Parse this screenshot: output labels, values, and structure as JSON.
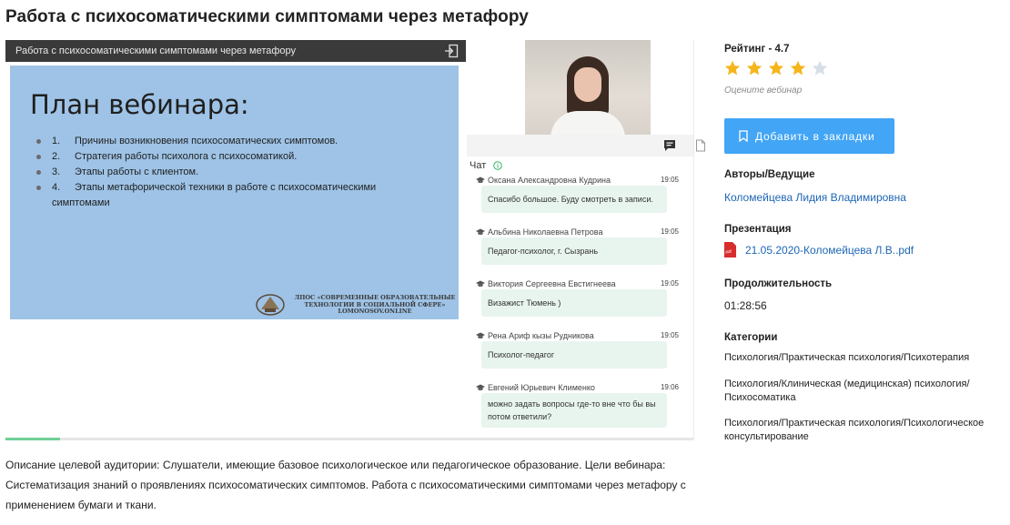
{
  "page": {
    "title": "Работа с психосоматическими симптомами через метафору"
  },
  "player": {
    "header_title": "Работа с психосоматическими симптомами через метафору",
    "slide": {
      "title": "План вебинара:",
      "items": [
        {
          "num": "1.",
          "text": "Причины возникновения психосоматических симптомов."
        },
        {
          "num": "2.",
          "text": "Стратегия работы психолога с психосоматикой."
        },
        {
          "num": "3.",
          "text": "Этапы работы с клиентом."
        },
        {
          "num": "4.",
          "text": "Этапы метафорической техники в работе с психосоматическими симптомами"
        }
      ],
      "logo_text": "ЛПОС «СОВРЕМЕННЫЕ ОБРАЗОВАТЕЛЬНЫЕ ТЕХНОЛОГИИ В СОЦИАЛЬНОЙ СФЕРЕ» LOMONOSOV.ONLINE"
    },
    "chat": {
      "label": "Чат",
      "messages": [
        {
          "author": "Оксана Александровна Кудрина",
          "time": "19:05",
          "text": "Спасибо большое. Буду смотреть в записи."
        },
        {
          "author": "Альбина Николаевна Петрова",
          "time": "19:05",
          "text": "Педагог-психолог, г. Сызрань"
        },
        {
          "author": "Виктория Сергеевна Евстигнеева",
          "time": "19:05",
          "text": "Визажист Тюмень )"
        },
        {
          "author": "Рена Ариф кызы Рудникова",
          "time": "19:05",
          "text": "Психолог-педагог"
        },
        {
          "author": "Евгений Юрьевич Клименко",
          "time": "19:06",
          "text": "можно задать вопросы где-то вне что бы вы потом ответили?"
        }
      ]
    },
    "progress": 0.08
  },
  "sidebar": {
    "rating_label": "Рейтинг - 4.7",
    "rating_value": 4,
    "rating_max": 5,
    "rate_hint": "Оцените вебинар",
    "bookmark_label": "Добавить в закладки",
    "authors_title": "Авторы/Ведущие",
    "author": "Коломейцева Лидия Владимировна",
    "presentation_title": "Презентация",
    "presentation_file": "21.05.2020-Коломейцева Л.В..pdf",
    "pdf_badge": "pdf",
    "duration_title": "Продолжительность",
    "duration": "01:28:56",
    "categories_title": "Категории",
    "categories": [
      "Психология/Практическая психология/Психотерапия",
      "Психология/Клиническая (медицинская) психология/Психосоматика",
      "Психология/Практическая психология/Психологическое консультирование"
    ]
  },
  "description": "Описание целевой аудитории: Слушатели, имеющие базовое психологическое или педагогическое образование. Цели вебинара: Систематизация знаний о проявлениях психосоматических симптомов. Работа с психосоматическими симптомами через метафору с применением бумаги и ткани.",
  "colors": {
    "accent": "#42a5f5",
    "link": "#1e66b5",
    "star_on": "#f5b51b",
    "star_off": "#d6dfe8",
    "chat_bubble": "#e8f5ee",
    "slide_bg": "#9ec3e6"
  }
}
